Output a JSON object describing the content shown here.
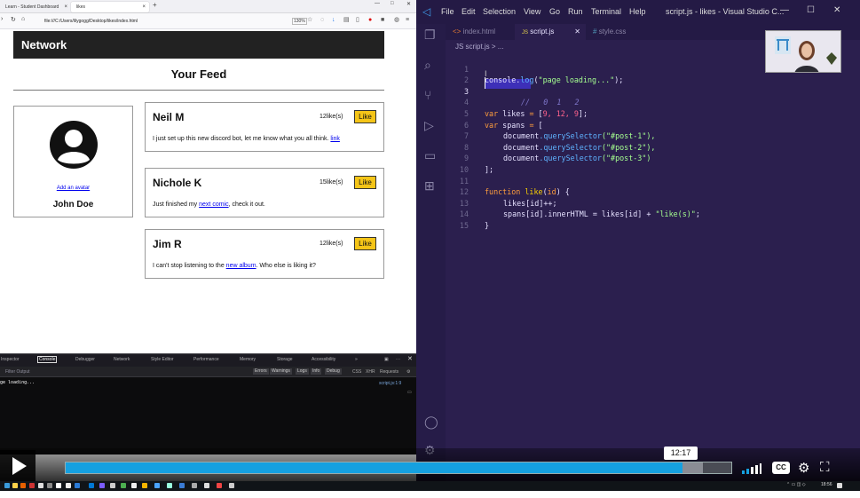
{
  "firefox": {
    "tabs": [
      {
        "label": "Learn - Student Dashboard"
      },
      {
        "label": "likes"
      }
    ],
    "url": "file:///C:/Users/lilygogg/Desktop/likes/index.html",
    "zoom": "130%",
    "page": {
      "site_title": "Network",
      "feed_heading": "Your Feed",
      "profile": {
        "add_avatar_link": "Add an avatar",
        "name": "John Doe"
      },
      "like_button_label": "Like",
      "posts": [
        {
          "author": "Neil M",
          "likes": "12like(s)",
          "text": "I just set up this new discord bot, let me know what you all think.",
          "link": "link",
          "text_after": ""
        },
        {
          "author": "Nichole K",
          "likes": "15like(s)",
          "text": "Just finished my",
          "link": "next comic",
          "text_after": ", check it out."
        },
        {
          "author": "Jim R",
          "likes": "12like(s)",
          "text": "I can't stop listening to the",
          "link": "new album",
          "text_after": ". Who else is liking it?"
        }
      ]
    },
    "devtools": {
      "tabs": [
        "Inspector",
        "Console",
        "Debugger",
        "Network",
        "Style Editor",
        "Performance",
        "Memory",
        "Storage",
        "Accessibility"
      ],
      "active_tab": "Console",
      "filter_placeholder": "Filter Output",
      "levels": [
        "Errors",
        "Warnings",
        "Logs",
        "Info",
        "Debug"
      ],
      "extra_filters": [
        "CSS",
        "XHR",
        "Requests"
      ],
      "log_message": "ge loading...",
      "log_source": "script.js:1:9"
    }
  },
  "vscode": {
    "menu": [
      "File",
      "Edit",
      "Selection",
      "View",
      "Go",
      "Run",
      "Terminal",
      "Help"
    ],
    "window_title": "script.js - likes - Visual Studio C...",
    "tabs": [
      {
        "icon": "<>",
        "label": "index.html",
        "active": false
      },
      {
        "icon": "JS",
        "label": "script.js",
        "active": true
      },
      {
        "icon": "#",
        "label": "style.css",
        "active": false
      }
    ],
    "breadcrumb": "JS script.js > ...",
    "lines": [
      {
        "n": "1"
      },
      {
        "n": "2"
      },
      {
        "n": "3"
      },
      {
        "n": "4"
      },
      {
        "n": "5"
      },
      {
        "n": "6"
      },
      {
        "n": "7"
      },
      {
        "n": "8"
      },
      {
        "n": "9"
      },
      {
        "n": "10"
      },
      {
        "n": "11"
      },
      {
        "n": "12"
      },
      {
        "n": "13"
      },
      {
        "n": "14"
      },
      {
        "n": "15"
      }
    ],
    "code": {
      "l1_a": "console",
      "l1_b": ".",
      "l1_c": "log",
      "l1_d": "(",
      "l1_e": "\"page loading...\"",
      "l1_f": ");",
      "l3_comment": "//   0  1   2",
      "l4_kw": "var",
      "l4_id": " likes ",
      "l4_op": "= ",
      "l4_b1": "[",
      "l4_n": "9, 12, 9",
      "l4_b2": "];",
      "l5_kw": "var",
      "l5_id": " spans ",
      "l5_op": "= ",
      "l5_b": "[",
      "qs_obj": "document",
      "qs_fn": ".querySelector",
      "l6_arg": "(\"#post-1\"),",
      "l7_arg": "(\"#post-2\"),",
      "l8_arg": "(\"#post-3\")",
      "l9": "];",
      "l11_kw": "function",
      "l11_fn": " like",
      "l11_p1": "(",
      "l11_param": "id",
      "l11_p2": ") {",
      "l12": "likes[id]++;",
      "l13_a": "spans[id].innerHTML ",
      "l13_b": "= likes[id] + ",
      "l13_c": "\"like(s)\"",
      "l13_d": ";",
      "l14": "}"
    }
  },
  "player": {
    "time": "12:17",
    "progress_fraction": 0.927,
    "cc_label": "CC"
  },
  "taskbar": {
    "clock": "18:56"
  },
  "colors": {
    "vscode_bg": "#2b1f4e",
    "like_yellow": "#f5c518",
    "seek_blue": "#15a0e0"
  }
}
